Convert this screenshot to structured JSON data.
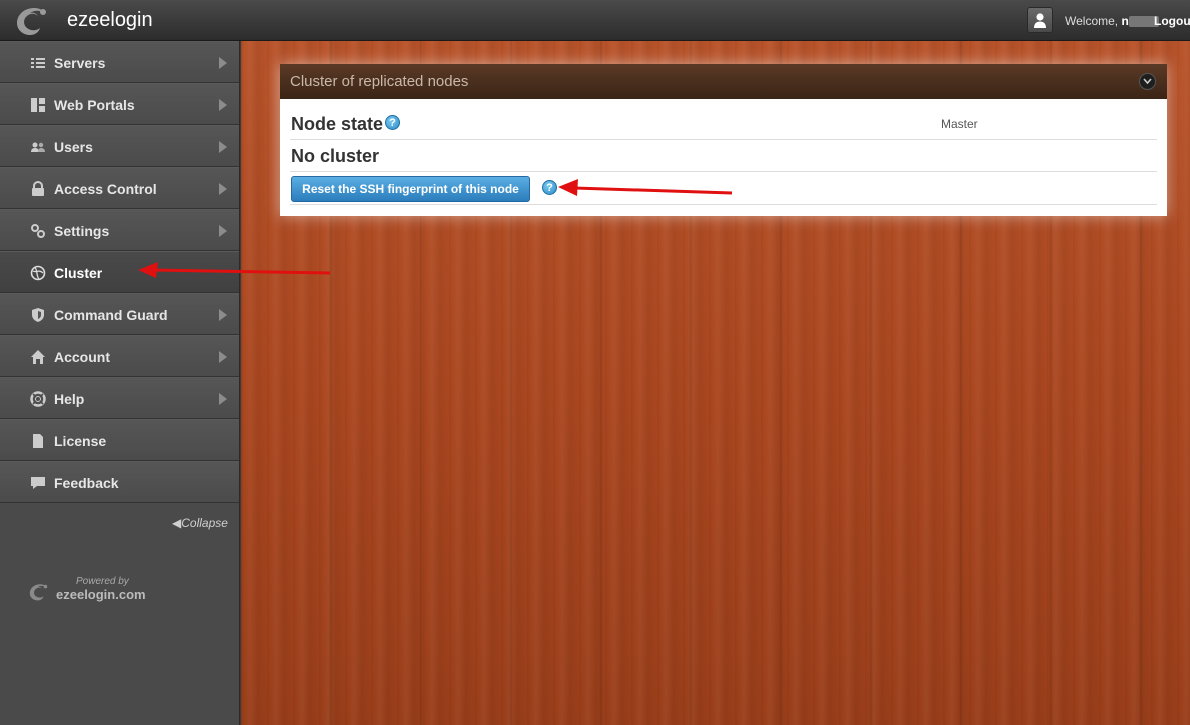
{
  "header": {
    "brand": "ezeelogin",
    "welcome_prefix": "Welcome,",
    "username_initial": "n",
    "logout_label": "Logout"
  },
  "sidebar": {
    "items": [
      {
        "label": "Servers",
        "icon": "list-icon",
        "has_submenu": true,
        "active": false
      },
      {
        "label": "Web Portals",
        "icon": "grid-icon",
        "has_submenu": true,
        "active": false
      },
      {
        "label": "Users",
        "icon": "users-icon",
        "has_submenu": true,
        "active": false
      },
      {
        "label": "Access Control",
        "icon": "lock-icon",
        "has_submenu": true,
        "active": false
      },
      {
        "label": "Settings",
        "icon": "gears-icon",
        "has_submenu": true,
        "active": false
      },
      {
        "label": "Cluster",
        "icon": "globe-icon",
        "has_submenu": false,
        "active": true
      },
      {
        "label": "Command Guard",
        "icon": "shield-icon",
        "has_submenu": true,
        "active": false
      },
      {
        "label": "Account",
        "icon": "home-icon",
        "has_submenu": true,
        "active": false
      },
      {
        "label": "Help",
        "icon": "lifebuoy-icon",
        "has_submenu": true,
        "active": false
      },
      {
        "label": "License",
        "icon": "document-icon",
        "has_submenu": false,
        "active": false
      },
      {
        "label": "Feedback",
        "icon": "comment-icon",
        "has_submenu": false,
        "active": false
      }
    ],
    "collapse_label": "Collapse",
    "powered_by": "Powered by",
    "powered_domain": "ezeelogin.com"
  },
  "panel": {
    "title": "Cluster of replicated nodes",
    "node_state_label": "Node state",
    "node_state_value": "Master",
    "no_cluster_label": "No cluster",
    "reset_button_label": "Reset the SSH fingerprint of this node",
    "help_glyph": "?"
  },
  "colors": {
    "accent_button": "#2b7dbc",
    "annotation_arrow": "#e01010",
    "wood": "#a9461f"
  }
}
